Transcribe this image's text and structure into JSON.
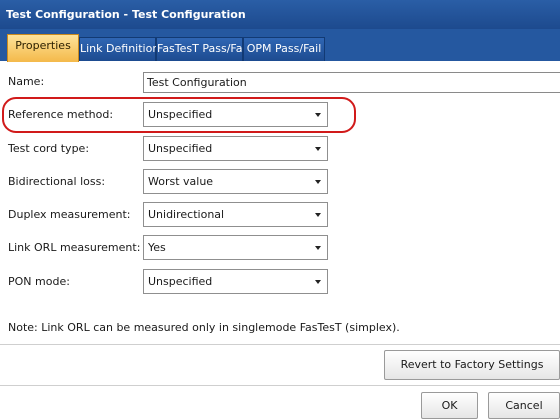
{
  "window": {
    "title": "Test Configuration - Test Configuration"
  },
  "tabs": [
    {
      "label": "Properties",
      "active": true
    },
    {
      "label": "Link Definition",
      "active": false
    },
    {
      "label": "FasTesT Pass/Fail",
      "active": false
    },
    {
      "label": "OPM Pass/Fail",
      "active": false
    }
  ],
  "fields": {
    "name": {
      "label": "Name:",
      "value": "Test Configuration"
    },
    "reference_method": {
      "label": "Reference method:",
      "value": "Unspecified"
    },
    "test_cord_type": {
      "label": "Test cord type:",
      "value": "Unspecified"
    },
    "bidirectional_loss": {
      "label": "Bidirectional loss:",
      "value": "Worst value"
    },
    "duplex_measurement": {
      "label": "Duplex measurement:",
      "value": "Unidirectional"
    },
    "link_orl_measurement": {
      "label": "Link ORL measurement:",
      "value": "Yes"
    },
    "pon_mode": {
      "label": "PON mode:",
      "value": "Unspecified"
    }
  },
  "note": "Note: Link ORL can be measured only in singlemode FasTesT (simplex).",
  "buttons": {
    "revert": "Revert to Factory Settings",
    "ok": "OK",
    "cancel": "Cancel"
  },
  "colors": {
    "titlebar": "#1d4a8e",
    "active_tab": "#f4b94a",
    "highlight_ring": "#d11a1a"
  }
}
